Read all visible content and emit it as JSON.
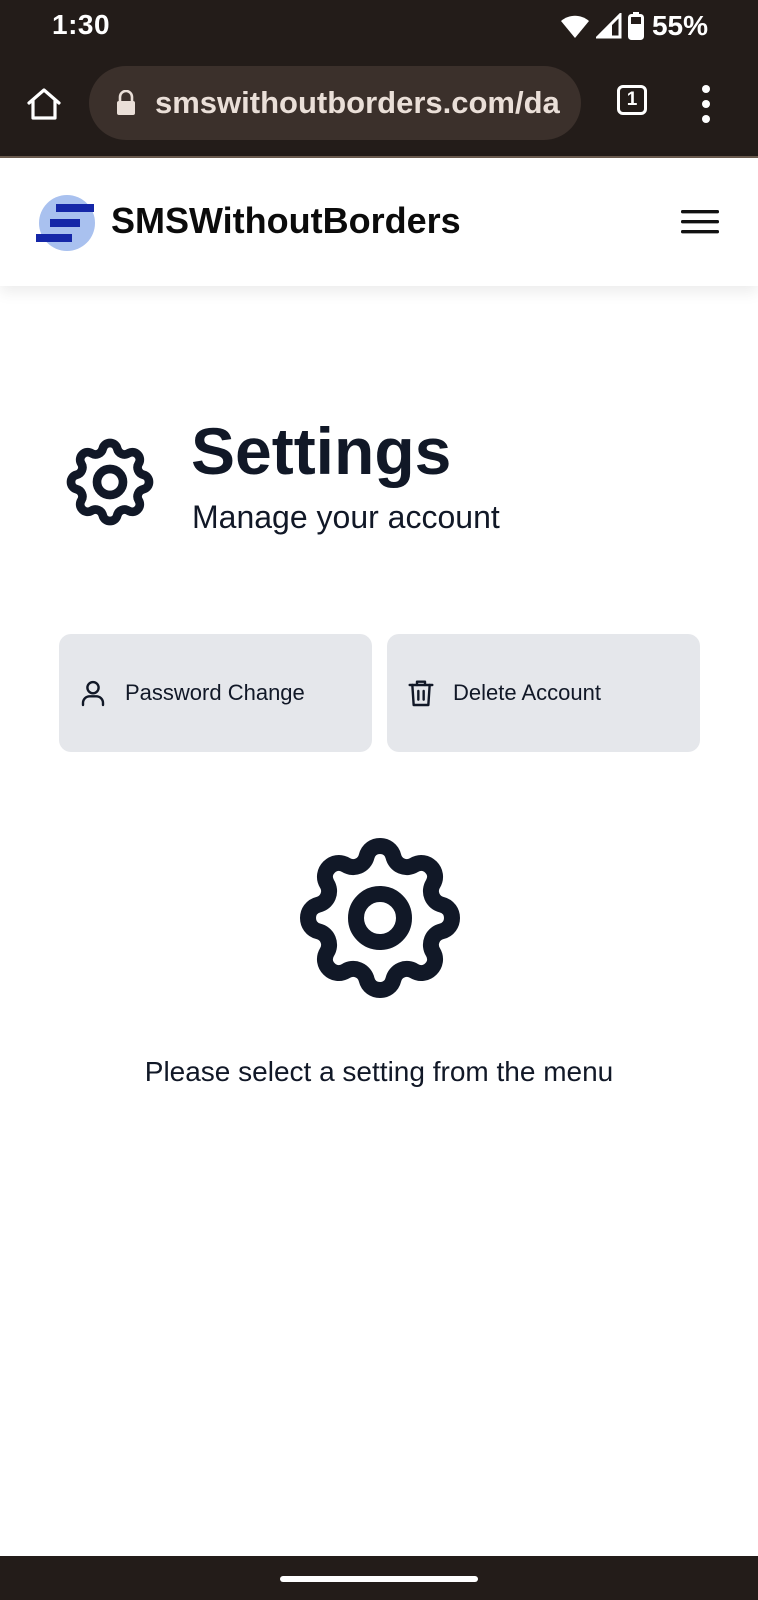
{
  "status_bar": {
    "time": "1:30",
    "battery": "55%"
  },
  "browser": {
    "url": "smswithoutborders.com/da",
    "tab_count": "1"
  },
  "header": {
    "brand_name": "SMSWithoutBorders",
    "colors": {
      "logo_circle": "#a9c1ef",
      "logo_bars": "#1527a8"
    }
  },
  "page": {
    "title": "Settings",
    "subtitle": "Manage your account",
    "buttons": [
      {
        "label": "Password Change",
        "icon": "user-icon"
      },
      {
        "label": "Delete Account",
        "icon": "trash-icon"
      }
    ],
    "empty_message": "Please select a setting from the menu"
  }
}
